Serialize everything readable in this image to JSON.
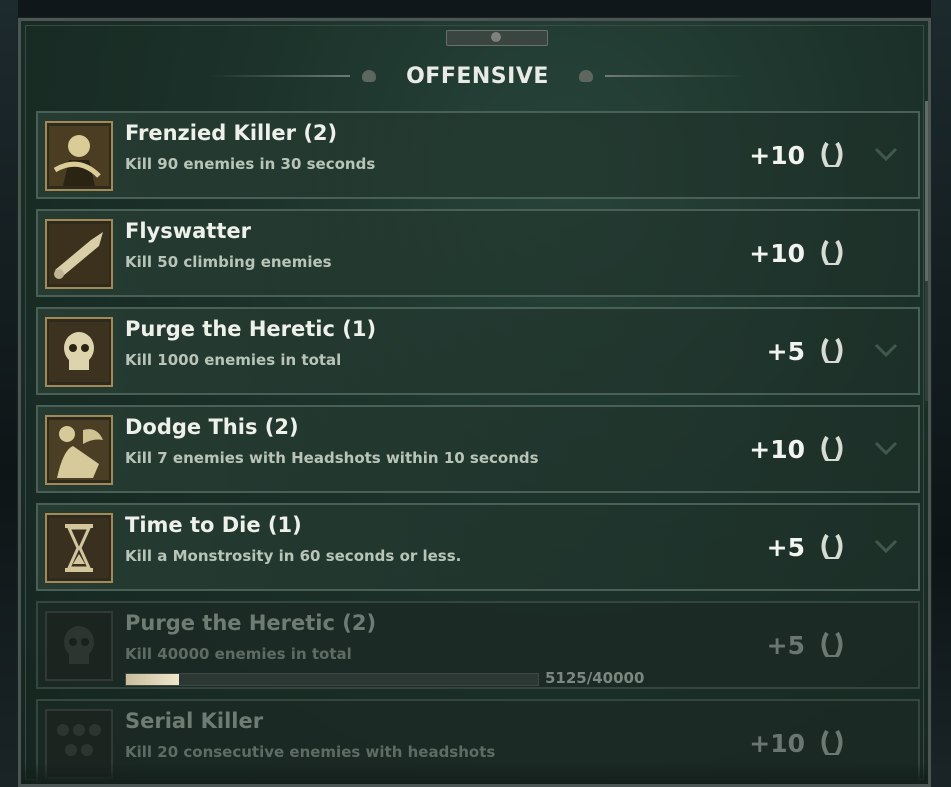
{
  "header": {
    "title": "OFFENSIVE"
  },
  "achievements": [
    {
      "name": "Frenzied Killer (2)",
      "desc": "Kill 90 enemies in 30 seconds",
      "points": "+10",
      "icon": "frenzied-killer-icon",
      "locked": false
    },
    {
      "name": "Flyswatter",
      "desc": "Kill 50 climbing enemies",
      "points": "+10",
      "icon": "flyswatter-icon",
      "locked": false
    },
    {
      "name": "Purge the Heretic (1)",
      "desc": "Kill 1000 enemies in total",
      "points": "+5",
      "icon": "skull-icon",
      "locked": false
    },
    {
      "name": "Dodge This (2)",
      "desc": "Kill 7 enemies with Headshots within 10 seconds",
      "points": "+10",
      "icon": "dodge-this-icon",
      "locked": false
    },
    {
      "name": "Time to Die (1)",
      "desc": "Kill a Monstrosity in 60 seconds or less.",
      "points": "+5",
      "icon": "hourglass-icon",
      "locked": false
    },
    {
      "name": "Purge the Heretic (2)",
      "desc": "Kill 40000 enemies in total",
      "points": "+5",
      "icon": "skull-icon",
      "locked": true,
      "progress_text": "5125/40000",
      "progress": 0.128
    },
    {
      "name": "Serial Killer",
      "desc": "Kill 20 consecutive enemies with headshots",
      "points": "+10",
      "icon": "serial-killer-icon",
      "locked": true
    }
  ],
  "colors": {
    "accent_gold": "#a38a55",
    "panel_green": "#1b3129",
    "text_light": "#eef0ea"
  }
}
